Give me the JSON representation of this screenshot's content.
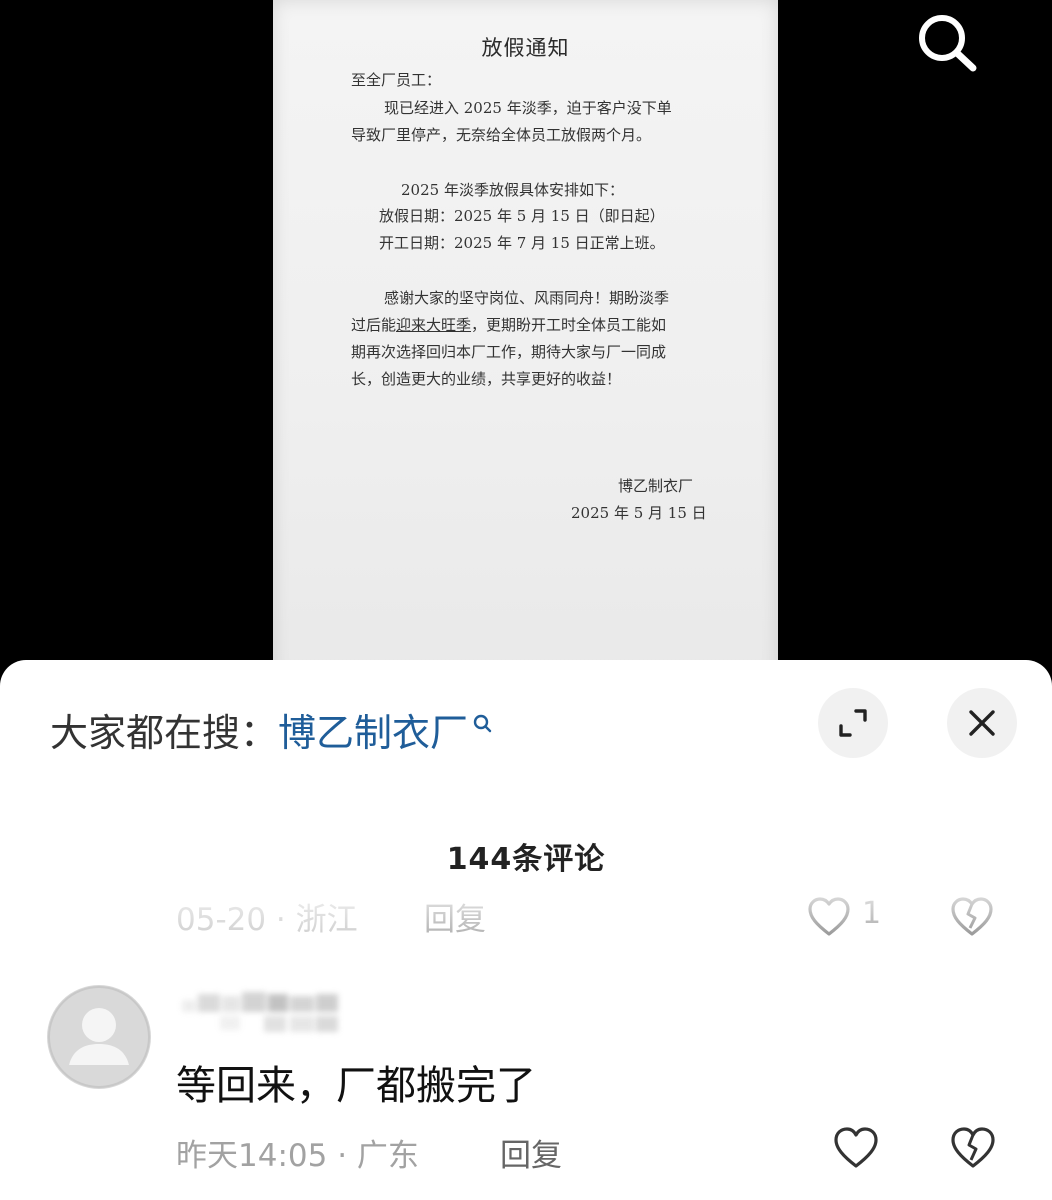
{
  "notice": {
    "title": "放假通知",
    "lines": [
      "至全厂员工：",
      "现已经进入 2025 年淡季，迫于客户没下单",
      "导致厂里停产，无奈给全体员工放假两个月。",
      "2025 年淡季放假具体安排如下：",
      "放假日期：2025 年 5 月 15 日（即日起）",
      "开工日期：2025 年 7 月 15 日正常上班。",
      "感谢大家的坚守岗位、风雨同舟！期盼淡季",
      "期再次选择回归本厂工作，期待大家与厂一同成",
      "长，创造更大的业绩，共享更好的收益！",
      "博乙制衣厂",
      "2025 年 5 月 15 日"
    ],
    "line8": {
      "before": "过后能",
      "underlined": "迎来大旺季",
      "after": "，更期盼开工时全体员工能如"
    }
  },
  "sheet": {
    "hot_search_prefix": "大家都在搜：",
    "hot_search_term": "博乙制衣厂",
    "comment_count": "144条评论"
  },
  "comments": [
    {
      "meta": "05-20 · 浙江",
      "reply": "回复",
      "likes": "1"
    },
    {
      "text": "等回来，厂都搬完了",
      "meta": "昨天14:05 · 广东",
      "reply": "回复"
    }
  ],
  "colors": {
    "accent_link": "#1f5d99",
    "meta_gray": "#a2a2a2"
  },
  "icons": [
    "search-icon",
    "expand-icon",
    "close-icon",
    "heart-icon",
    "broken-heart-icon",
    "avatar-placeholder"
  ]
}
